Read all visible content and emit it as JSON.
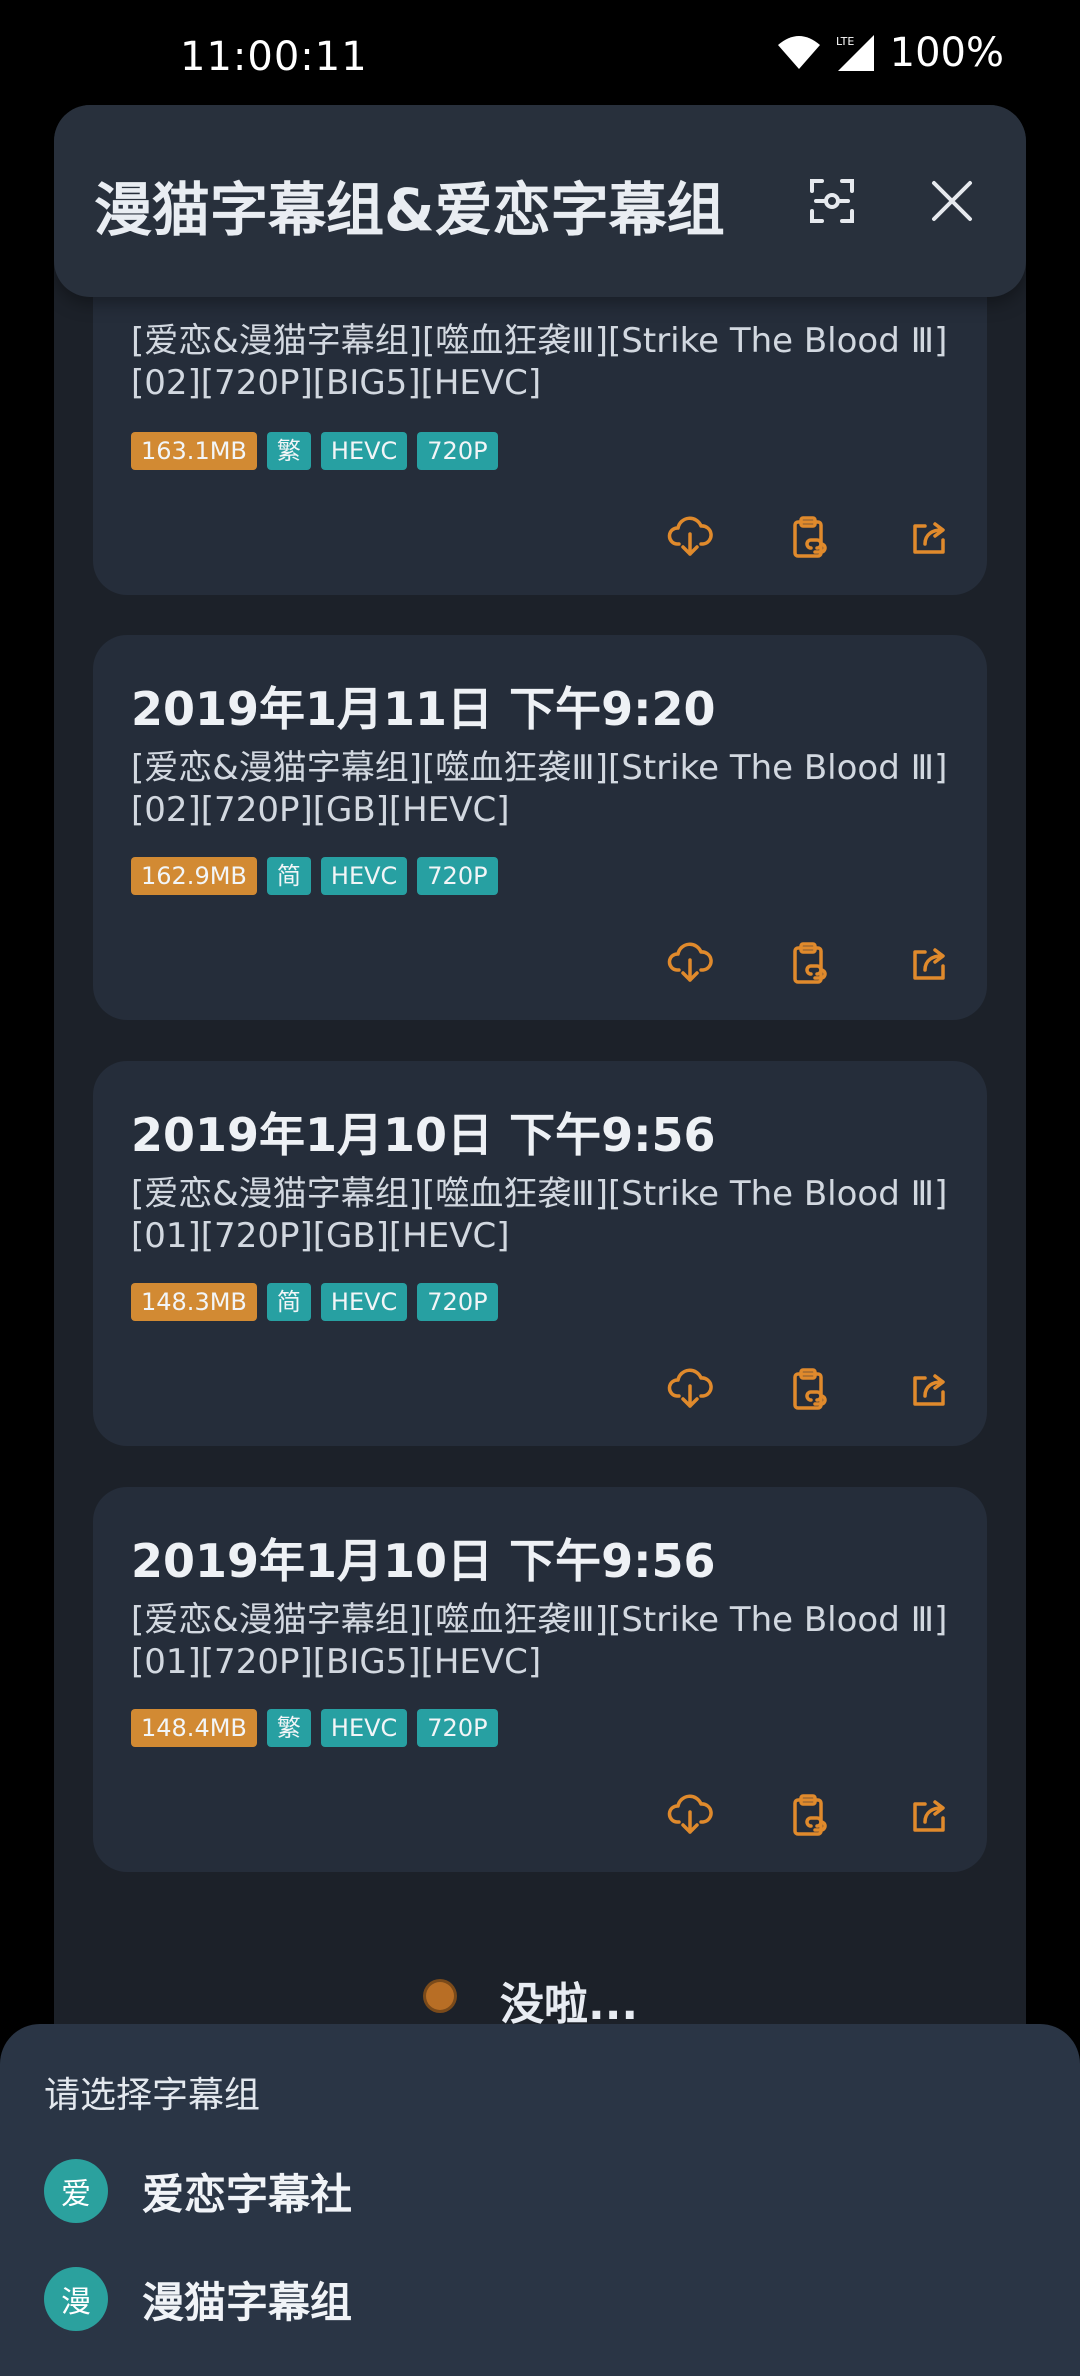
{
  "status_bar": {
    "time": "11:00:11",
    "network": "LTE",
    "battery": "100%"
  },
  "header": {
    "title": "漫猫字幕组&爱恋字幕组"
  },
  "accent_color": "#d28a33",
  "tag_color": "#27a0a2",
  "cards": [
    {
      "date": "",
      "name": "[爱恋&漫猫字幕组][噬血狂袭Ⅲ][Strike The Blood Ⅲ][02][720P][BIG5][HEVC]",
      "tags": [
        "163.1MB",
        "繁",
        "HEVC",
        "720P"
      ]
    },
    {
      "date": "2019年1月11日 下午9:20",
      "name": "[爱恋&漫猫字幕组][噬血狂袭Ⅲ][Strike The Blood Ⅲ][02][720P][GB][HEVC]",
      "tags": [
        "162.9MB",
        "简",
        "HEVC",
        "720P"
      ]
    },
    {
      "date": "2019年1月10日 下午9:56",
      "name": "[爱恋&漫猫字幕组][噬血狂袭Ⅲ][Strike The Blood Ⅲ][01][720P][GB][HEVC]",
      "tags": [
        "148.3MB",
        "简",
        "HEVC",
        "720P"
      ]
    },
    {
      "date": "2019年1月10日 下午9:56",
      "name": "[爱恋&漫猫字幕组][噬血狂袭Ⅲ][Strike The Blood Ⅲ][01][720P][BIG5][HEVC]",
      "tags": [
        "148.4MB",
        "繁",
        "HEVC",
        "720P"
      ]
    }
  ],
  "end_text": "没啦...",
  "sheet": {
    "title": "请选择字幕组",
    "items": [
      {
        "avatar": "爱",
        "label": "爱恋字幕社"
      },
      {
        "avatar": "漫",
        "label": "漫猫字幕组"
      }
    ]
  }
}
